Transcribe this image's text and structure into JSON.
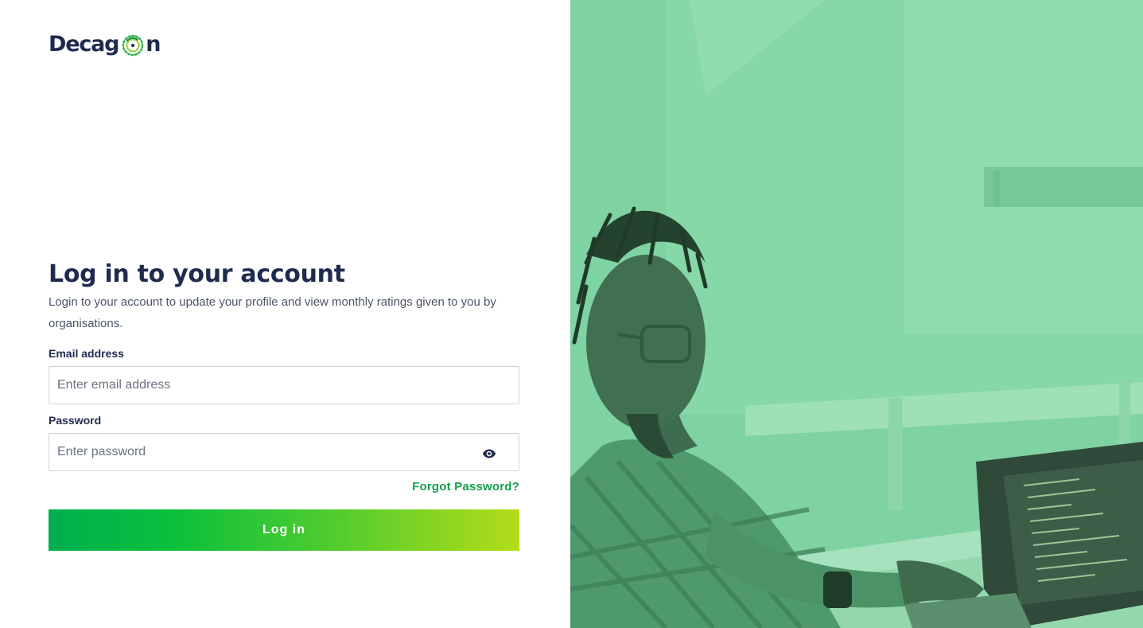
{
  "brand": {
    "logo_text_before": "Decag",
    "logo_text_after": "n",
    "primary_color": "#1f2b4e",
    "accent_green": "#14a04b"
  },
  "login": {
    "title": "Log in to your account",
    "subtitle": "Login to your account to update your profile and view monthly ratings given to you by organisations.",
    "email_label": "Email address",
    "email_placeholder": "Enter email address",
    "email_value": "",
    "password_label": "Password",
    "password_placeholder": "Enter password",
    "password_value": "",
    "password_toggle_icon": "eye-icon",
    "forgot_label": "Forgot Password?",
    "submit_label": "Log in"
  },
  "hero": {
    "overlay_color": "#7dd3a0",
    "description_icon": "developer-at-laptop-photo"
  }
}
